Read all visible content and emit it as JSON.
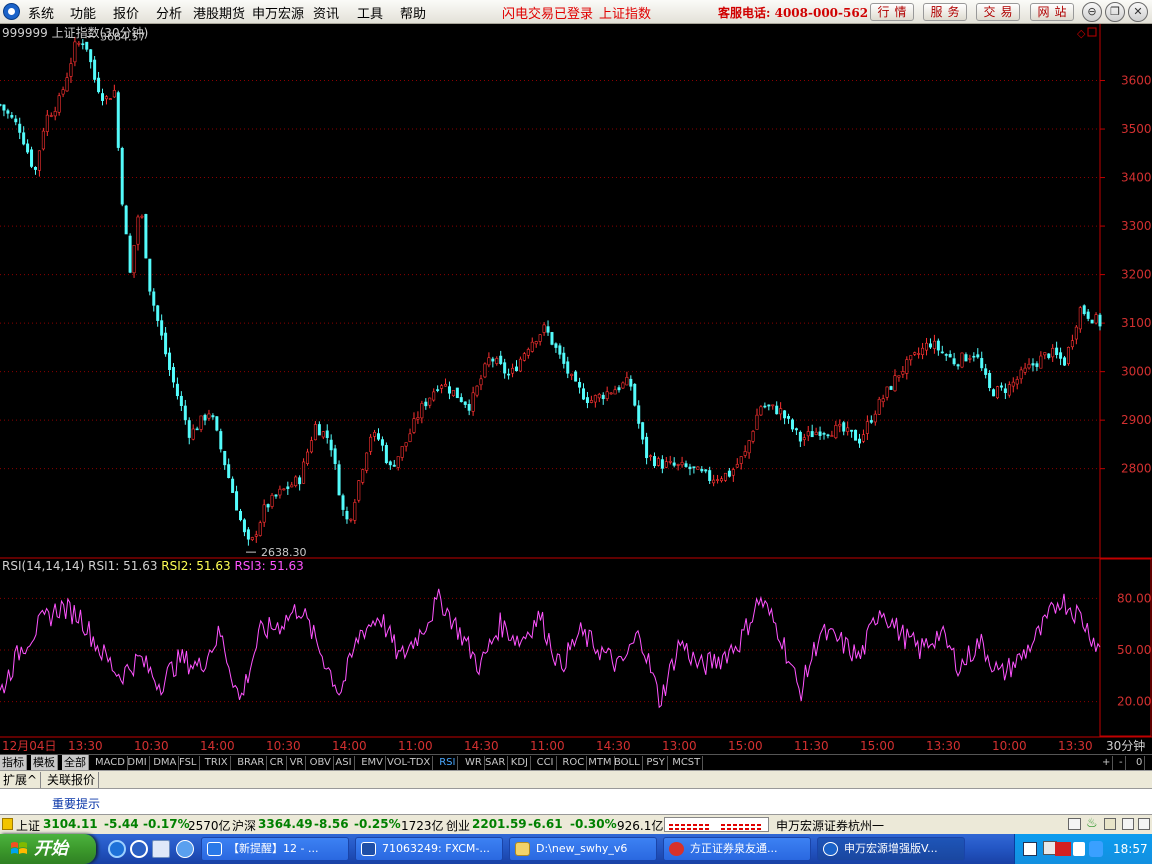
{
  "menubar": {
    "items": [
      "系统",
      "功能",
      "报价",
      "分析",
      "港股期货",
      "申万宏源",
      "资讯",
      "工具",
      "帮助"
    ],
    "login_status": "闪电交易已登录",
    "current_stock": "上证指数",
    "hotline": "客服电话: 4008-000-562",
    "buttons": [
      "行情",
      "服务",
      "交易",
      "网站"
    ]
  },
  "chart": {
    "title": "999999 上证指数(30分钟)",
    "high_label": "3684.57",
    "low_label": "2638.30",
    "rsi_params": "RSI(14,14,14)",
    "rsi1": "RSI1: 51.63",
    "rsi2": "RSI2: 51.63",
    "rsi3": "RSI3: 51.63",
    "period_label": "30分钟",
    "colors": {
      "up": "#ff3232",
      "down": "#54fcfc",
      "rsi": "#ff54ff",
      "axis": "#c00000",
      "grid": "#8b0000"
    }
  },
  "chart_data": {
    "type": "candlestick",
    "price_axis": {
      "ticks": [
        3600,
        3500,
        3400,
        3300,
        3200,
        3100,
        3000,
        2900,
        2800
      ],
      "min": 2620,
      "max": 3700
    },
    "rsi_axis": {
      "ticks": [
        80.0,
        50.0,
        20.0
      ],
      "min": 0,
      "max": 100
    },
    "time_ticks": [
      "12月04日",
      "13:30",
      "10:30",
      "14:00",
      "10:30",
      "14:00",
      "11:00",
      "14:30",
      "11:00",
      "14:30",
      "13:00",
      "15:00",
      "11:30",
      "15:00",
      "13:30",
      "10:00",
      "13:30"
    ],
    "close_path": [
      [
        0,
        3550
      ],
      [
        0.02,
        3500
      ],
      [
        0.035,
        3410
      ],
      [
        0.045,
        3520
      ],
      [
        0.06,
        3560
      ],
      [
        0.075,
        3670
      ],
      [
        0.085,
        3684.57
      ],
      [
        0.095,
        3600
      ],
      [
        0.105,
        3560
      ],
      [
        0.115,
        3580
      ],
      [
        0.12,
        3400
      ],
      [
        0.13,
        3200
      ],
      [
        0.14,
        3350
      ],
      [
        0.15,
        3170
      ],
      [
        0.17,
        3000
      ],
      [
        0.19,
        2870
      ],
      [
        0.21,
        2920
      ],
      [
        0.225,
        2810
      ],
      [
        0.245,
        2660
      ],
      [
        0.25,
        2638.3
      ],
      [
        0.265,
        2720
      ],
      [
        0.28,
        2750
      ],
      [
        0.3,
        2780
      ],
      [
        0.315,
        2890
      ],
      [
        0.33,
        2860
      ],
      [
        0.345,
        2690
      ],
      [
        0.35,
        2700
      ],
      [
        0.37,
        2870
      ],
      [
        0.38,
        2860
      ],
      [
        0.39,
        2800
      ],
      [
        0.405,
        2850
      ],
      [
        0.42,
        2920
      ],
      [
        0.44,
        2980
      ],
      [
        0.47,
        2930
      ],
      [
        0.49,
        3030
      ],
      [
        0.51,
        2990
      ],
      [
        0.53,
        3060
      ],
      [
        0.545,
        3090
      ],
      [
        0.56,
        3030
      ],
      [
        0.575,
        2970
      ],
      [
        0.59,
        2940
      ],
      [
        0.61,
        2960
      ],
      [
        0.63,
        2980
      ],
      [
        0.645,
        2830
      ],
      [
        0.66,
        2810
      ],
      [
        0.69,
        2800
      ],
      [
        0.71,
        2780
      ],
      [
        0.73,
        2790
      ],
      [
        0.745,
        2830
      ],
      [
        0.76,
        2930
      ],
      [
        0.78,
        2920
      ],
      [
        0.8,
        2860
      ],
      [
        0.82,
        2880
      ],
      [
        0.84,
        2880
      ],
      [
        0.86,
        2860
      ],
      [
        0.875,
        2920
      ],
      [
        0.9,
        3000
      ],
      [
        0.93,
        3060
      ],
      [
        0.955,
        3020
      ],
      [
        0.975,
        3040
      ],
      [
        0.99,
        2960
      ],
      [
        1.0,
        2960
      ],
      [
        1.01,
        2970
      ],
      [
        1.03,
        3010
      ],
      [
        1.05,
        3040
      ],
      [
        1.065,
        3020
      ],
      [
        1.08,
        3130
      ],
      [
        1.1,
        3100
      ]
    ],
    "rsi_path": [
      [
        0,
        25
      ],
      [
        0.02,
        50
      ],
      [
        0.04,
        65
      ],
      [
        0.06,
        75
      ],
      [
        0.08,
        70
      ],
      [
        0.1,
        50
      ],
      [
        0.12,
        35
      ],
      [
        0.14,
        45
      ],
      [
        0.16,
        30
      ],
      [
        0.18,
        45
      ],
      [
        0.2,
        40
      ],
      [
        0.22,
        60
      ],
      [
        0.24,
        20
      ],
      [
        0.26,
        60
      ],
      [
        0.28,
        65
      ],
      [
        0.3,
        75
      ],
      [
        0.32,
        50
      ],
      [
        0.34,
        25
      ],
      [
        0.36,
        60
      ],
      [
        0.38,
        70
      ],
      [
        0.4,
        45
      ],
      [
        0.42,
        60
      ],
      [
        0.44,
        80
      ],
      [
        0.46,
        60
      ],
      [
        0.48,
        40
      ],
      [
        0.5,
        65
      ],
      [
        0.52,
        55
      ],
      [
        0.54,
        70
      ],
      [
        0.56,
        40
      ],
      [
        0.58,
        60
      ],
      [
        0.6,
        50
      ],
      [
        0.62,
        40
      ],
      [
        0.64,
        60
      ],
      [
        0.66,
        20
      ],
      [
        0.68,
        55
      ],
      [
        0.7,
        40
      ],
      [
        0.72,
        45
      ],
      [
        0.74,
        55
      ],
      [
        0.76,
        80
      ],
      [
        0.78,
        60
      ],
      [
        0.8,
        25
      ],
      [
        0.82,
        60
      ],
      [
        0.84,
        55
      ],
      [
        0.86,
        45
      ],
      [
        0.88,
        75
      ],
      [
        0.9,
        60
      ],
      [
        0.92,
        50
      ],
      [
        0.94,
        60
      ],
      [
        0.96,
        40
      ],
      [
        0.98,
        55
      ],
      [
        1.0,
        35
      ],
      [
        1.02,
        45
      ],
      [
        1.04,
        60
      ],
      [
        1.06,
        80
      ],
      [
        1.08,
        70
      ],
      [
        1.1,
        50
      ]
    ]
  },
  "indicators": {
    "side_tabs": [
      "指标",
      "模板",
      "全部"
    ],
    "items": [
      "MACD",
      "DMI",
      "DMA",
      "FSL",
      "TRIX",
      "BRAR",
      "CR",
      "VR",
      "OBV",
      "ASI",
      "EMV",
      "VOL-TDX",
      "RSI",
      "WR",
      "SAR",
      "KDJ",
      "CCI",
      "ROC",
      "MTM",
      "BOLL",
      "PSY",
      "MCST"
    ],
    "active": "RSI",
    "right": [
      "+",
      "-",
      "0"
    ]
  },
  "lower_tabs": [
    "扩展^",
    "关联报价"
  ],
  "notice": "重要提示",
  "statusbar": {
    "sh_name": "上证",
    "sh_value": "3104.11",
    "sh_change": "-5.44",
    "sh_pct": "-0.17%",
    "sh_amount": "2570亿",
    "hs_name": "沪深",
    "hs_value": "3364.49",
    "hs_change": "-8.56",
    "hs_pct": "-0.25%",
    "hs_amount": "1723亿",
    "cy_name": "创业",
    "cy_value": "2201.59",
    "cy_change": "-6.61",
    "cy_pct": "-0.30%",
    "cy_amount": "926.1亿",
    "broker": "申万宏源证券杭州一"
  },
  "taskbar": {
    "start": "开始",
    "tasks": [
      "【新提醒】12 - ...",
      "71063249: FXCM-...",
      "D:\\new_swhy_v6",
      "方正证券泉友通...",
      "申万宏源增强版V..."
    ],
    "clock": "18:57"
  }
}
